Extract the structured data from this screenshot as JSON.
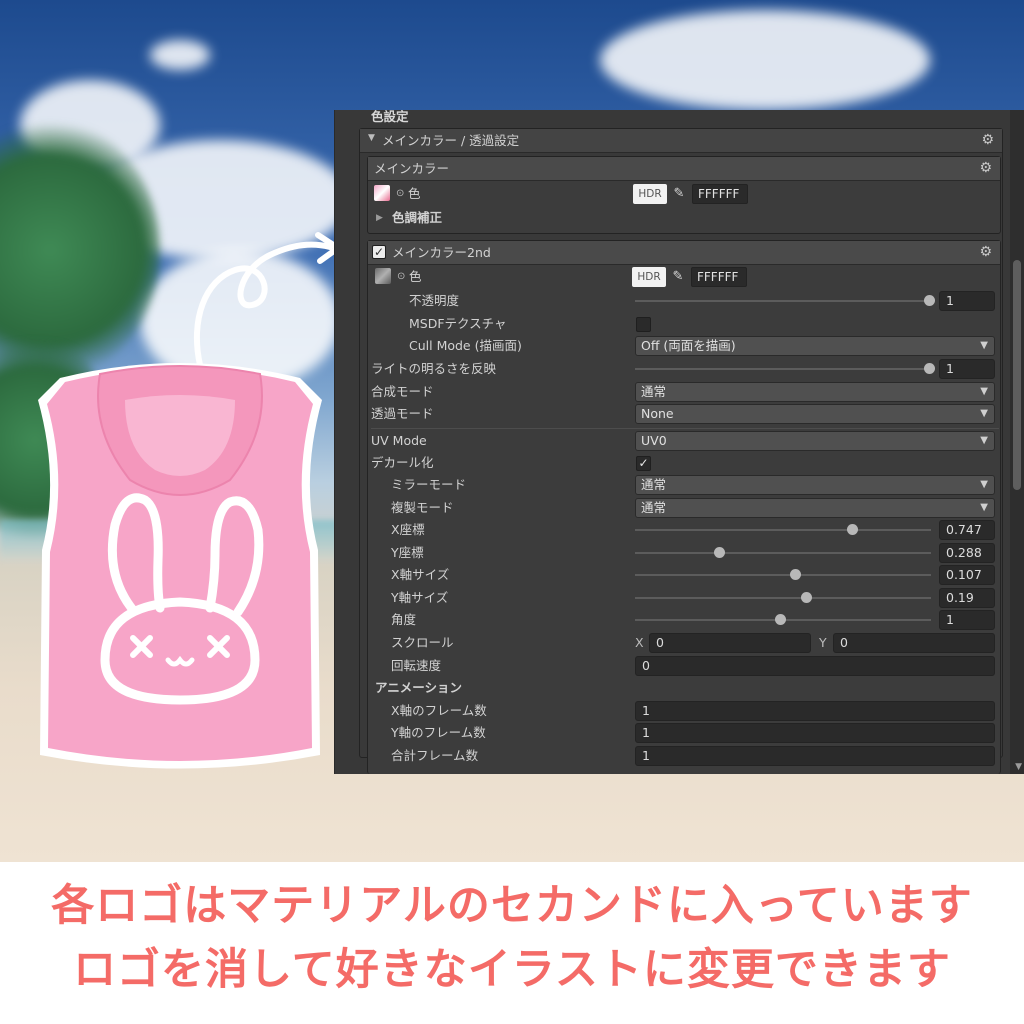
{
  "panel": {
    "top_label": "色設定",
    "section_main_transparency": {
      "title": "メインカラー / 透過設定"
    },
    "main_color_box": {
      "title": "メインカラー",
      "color_label": "色",
      "hdr": "HDR",
      "hex": "FFFFFF",
      "tone_label": "色調補正"
    },
    "main_color_2nd": {
      "title": "メインカラー2nd",
      "enabled": true,
      "color_label": "色",
      "hdr": "HDR",
      "hex": "FFFFFF",
      "opacity_label": "不透明度",
      "opacity_value": "1",
      "msdf_label": "MSDFテクスチャ",
      "cull_label": "Cull Mode (描画面)",
      "cull_value": "Off (両面を描画)",
      "light_label": "ライトの明るさを反映",
      "light_value": "1",
      "blend_label": "合成モード",
      "blend_value": "通常",
      "transp_label": "透過モード",
      "transp_value": "None",
      "uv_label": "UV Mode",
      "uv_value": "UV0",
      "decal_label": "デカール化",
      "decal_checked": true,
      "mirror_label": "ミラーモード",
      "mirror_value": "通常",
      "copy_label": "複製モード",
      "copy_value": "通常",
      "sliders": [
        {
          "label": "X座標",
          "value": "0.747",
          "fraction": 0.747
        },
        {
          "label": "Y座標",
          "value": "0.288",
          "fraction": 0.288
        },
        {
          "label": "X軸サイズ",
          "value": "0.107",
          "fraction": 0.55
        },
        {
          "label": "Y軸サイズ",
          "value": "0.19",
          "fraction": 0.59
        },
        {
          "label": "角度",
          "value": "1",
          "fraction": 0.5
        }
      ],
      "scroll_label": "スクロール",
      "scroll_x_label": "X",
      "scroll_x": "0",
      "scroll_y_label": "Y",
      "scroll_y": "0",
      "rotation_label": "回転速度",
      "rotation_value": "0",
      "animation_label": "アニメーション",
      "frames_x_label": "X軸のフレーム数",
      "frames_x": "1",
      "frames_y_label": "Y軸のフレーム数",
      "frames_y": "1",
      "frames_total_label": "合計フレーム数",
      "frames_total": "1"
    }
  },
  "caption": {
    "line1": "各ロゴはマテリアルのセカンドに入っています",
    "line2": "ロゴを消して好きなイラストに変更できます"
  },
  "colors": {
    "caption_text": "#f46b67",
    "hoodie_pink": "#f7a5c8",
    "panel_bg": "#383838"
  }
}
